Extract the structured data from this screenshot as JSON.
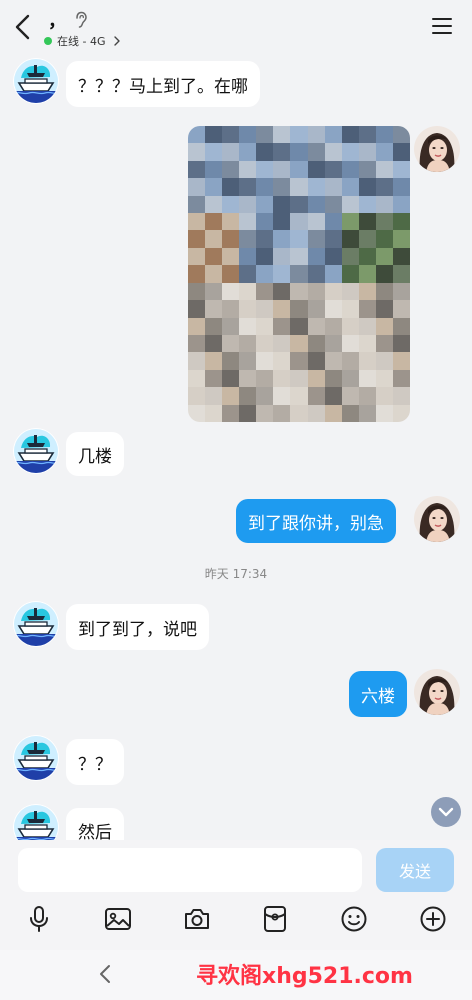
{
  "header": {
    "title": "，",
    "status": "在线 - 4G",
    "icons": {
      "back": "chevron-left-icon",
      "voice": "ear-icon",
      "menu": "hamburger-menu-icon"
    },
    "status_color": "#34c759"
  },
  "messages": {
    "m1": "？？？马上到了。在哪",
    "m3": "几楼",
    "m4": "到了跟你讲，别急",
    "timestamp": "昨天 17:34",
    "m5": "到了到了，说吧",
    "m6": "六楼",
    "m7": "？？",
    "m8": "然后"
  },
  "input": {
    "placeholder": "",
    "value": "",
    "send_label": "发送"
  },
  "toolbar": {
    "icons": [
      "microphone-icon",
      "image-icon",
      "camera-icon",
      "red-packet-icon",
      "emoji-icon",
      "plus-icon"
    ]
  },
  "watermark": "寻欢阁xhg521.com",
  "colors": {
    "outgoing_bubble": "#1e9bf0",
    "incoming_bubble": "#ffffff",
    "send_button": "#a8d3f6",
    "background": "#f2f3f5",
    "watermark": "#ff3344"
  }
}
